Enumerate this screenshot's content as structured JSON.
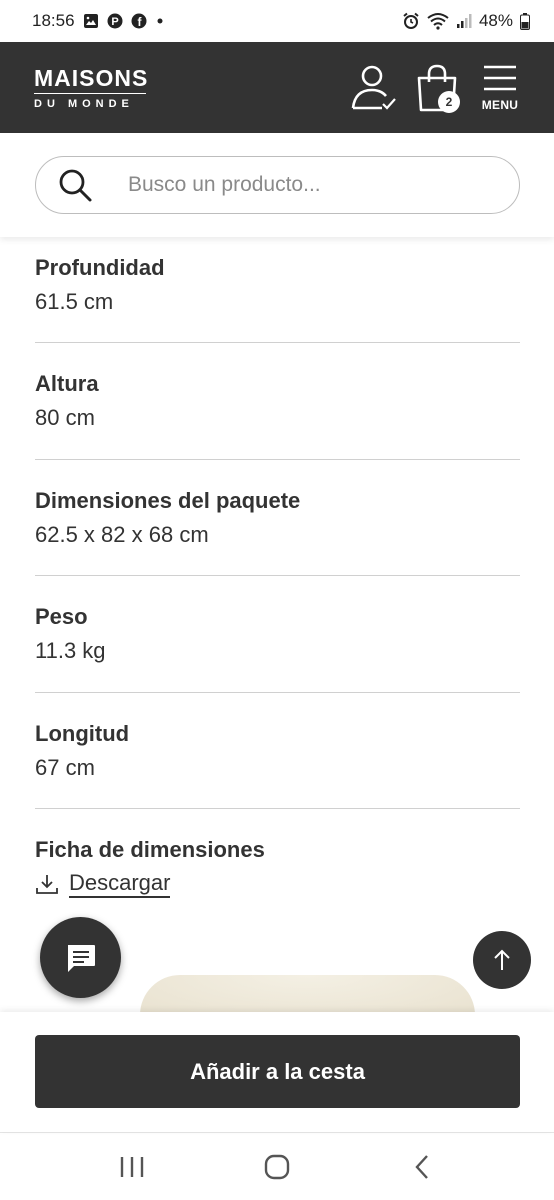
{
  "status_bar": {
    "time": "18:56",
    "battery": "48%",
    "notification_icons": [
      "image-icon",
      "pinterest-icon",
      "facebook-icon",
      "dot-icon"
    ],
    "system_icons": [
      "alarm-icon",
      "wifi-icon",
      "signal-icon",
      "battery-icon"
    ]
  },
  "header": {
    "logo_top": "MAISONS",
    "logo_bottom": "DU MONDE",
    "cart_count": "2",
    "menu_label": "MENU"
  },
  "search": {
    "placeholder": "Busco un producto..."
  },
  "specs": [
    {
      "label": "Profundidad",
      "value": "61.5 cm"
    },
    {
      "label": "Altura",
      "value": "80 cm"
    },
    {
      "label": "Dimensiones del paquete",
      "value": "62.5 x 82 x 68 cm"
    },
    {
      "label": "Peso",
      "value": "11.3 kg"
    },
    {
      "label": "Longitud",
      "value": "67 cm"
    }
  ],
  "dimension_sheet": {
    "label": "Ficha de dimensiones",
    "download_label": "Descargar"
  },
  "cart_bar": {
    "add_to_cart_label": "Añadir a la cesta"
  },
  "colors": {
    "header_bg": "#333333",
    "button_bg": "#333333",
    "divider": "#d0d0d0"
  }
}
